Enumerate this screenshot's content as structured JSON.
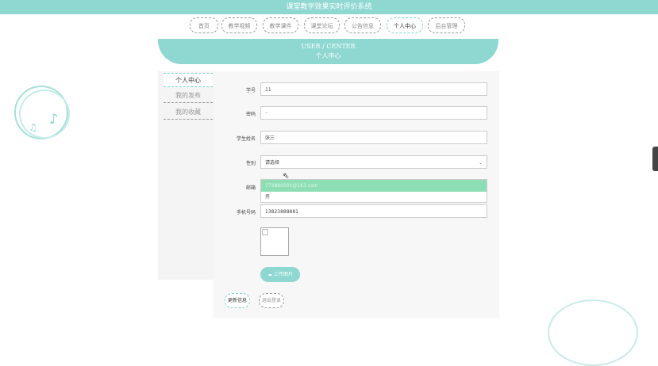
{
  "header": {
    "title": "课堂教学效果实时评价系统"
  },
  "nav": {
    "items": [
      {
        "label": "首页"
      },
      {
        "label": "教学视频"
      },
      {
        "label": "教学课件"
      },
      {
        "label": "课堂论坛"
      },
      {
        "label": "公告信息"
      },
      {
        "label": "个人中心",
        "active": true
      },
      {
        "label": "后台管理"
      }
    ]
  },
  "banner": {
    "en": "USER / CENTER",
    "cn": "个人中心"
  },
  "sidebar": {
    "items": [
      {
        "label": "个人中心",
        "active": true
      },
      {
        "label": "我的发布"
      },
      {
        "label": "我的收藏"
      }
    ]
  },
  "form": {
    "student_no": {
      "label": "学号",
      "value": "11"
    },
    "password": {
      "label": "密码",
      "value": "··"
    },
    "student_name": {
      "label": "学生姓名",
      "value": "张三"
    },
    "gender": {
      "label": "性别",
      "value": "请选择",
      "options": [
        "请选择",
        "男"
      ]
    },
    "email": {
      "label": "邮箱",
      "value": "773890001@163.com"
    },
    "phone": {
      "label": "手机号码",
      "value": "13823888881"
    },
    "upload_label": "上传图片",
    "update_label": "更新信息",
    "logout_label": "退出登录"
  },
  "colors": {
    "accent": "#8fd8d2",
    "selected_option": "#8ddfb3"
  }
}
